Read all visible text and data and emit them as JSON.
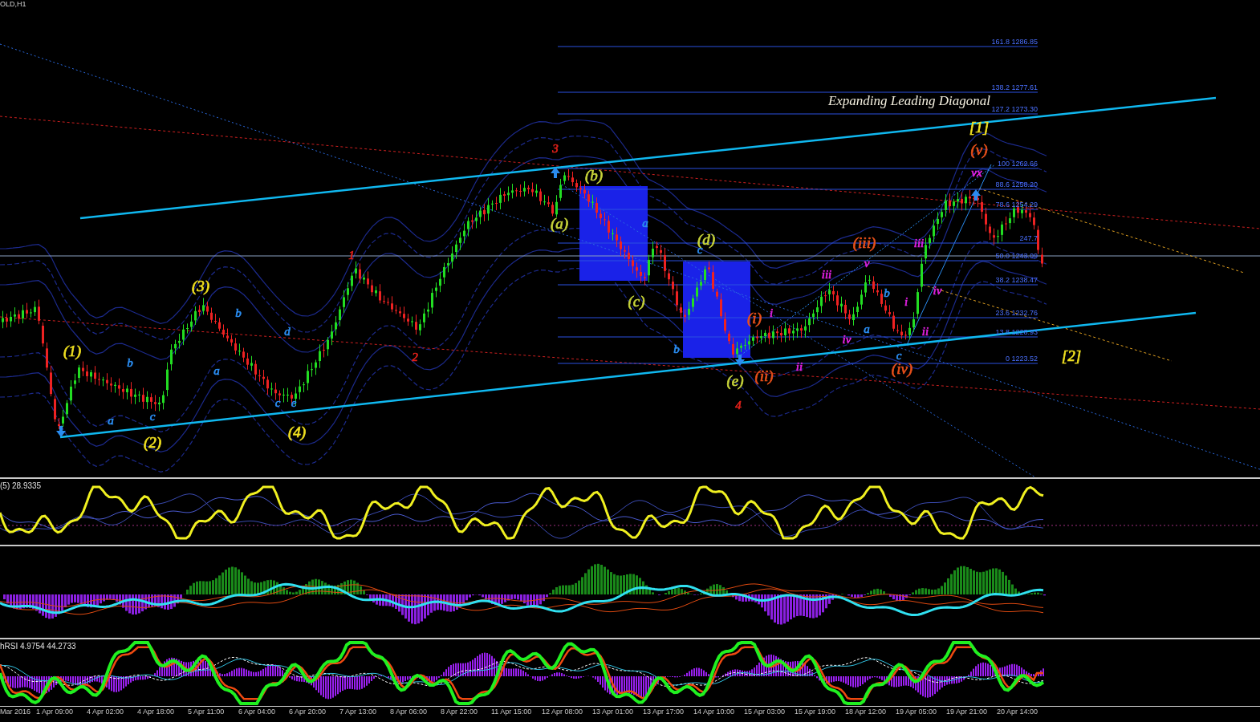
{
  "window": {
    "title": "OLD,H1"
  },
  "main_chart": {
    "annotation": "Expanding Leading Diagonal",
    "fib_levels": [
      {
        "label": "161.8 1286.85"
      },
      {
        "label": "138.2 1277.61"
      },
      {
        "label": "127.2 1273.30"
      },
      {
        "label": "100 1262.66"
      },
      {
        "label": "88.6 1258.20"
      },
      {
        "label": "78.6 1254.29"
      },
      {
        "label": "247.7"
      },
      {
        "label": "50.0 1243.09"
      },
      {
        "label": "38.2 1238.47"
      },
      {
        "label": "23.6 1232.76"
      },
      {
        "label": "13.8 1228.93"
      },
      {
        "label": "0 1223.52"
      }
    ],
    "wave_labels": [
      {
        "text": "(1)",
        "color": "#f0e020"
      },
      {
        "text": "a",
        "color": "#2a8cf0"
      },
      {
        "text": "b",
        "color": "#2a8cf0"
      },
      {
        "text": "(2)",
        "color": "#f0e020"
      },
      {
        "text": "c",
        "color": "#2a8cf0"
      },
      {
        "text": "(3)",
        "color": "#f0e020"
      },
      {
        "text": "a",
        "color": "#2a8cf0"
      },
      {
        "text": "b",
        "color": "#2a8cf0"
      },
      {
        "text": "c",
        "color": "#2a8cf0"
      },
      {
        "text": "d",
        "color": "#2a8cf0"
      },
      {
        "text": "e",
        "color": "#2a8cf0"
      },
      {
        "text": "(4)",
        "color": "#f0e020"
      },
      {
        "text": "1",
        "color": "#e0201a"
      },
      {
        "text": "2",
        "color": "#e0201a"
      },
      {
        "text": "3",
        "color": "#e0201a"
      },
      {
        "text": "(a)",
        "color": "#c8d43a"
      },
      {
        "text": "(b)",
        "color": "#c8d43a"
      },
      {
        "text": "(c)",
        "color": "#c8d43a"
      },
      {
        "text": "a",
        "color": "#2a8cf0"
      },
      {
        "text": "b",
        "color": "#2a8cf0"
      },
      {
        "text": "c",
        "color": "#2a8cf0"
      },
      {
        "text": "(d)",
        "color": "#c8d43a"
      },
      {
        "text": "(e)",
        "color": "#c8d43a"
      },
      {
        "text": "4",
        "color": "#e0201a"
      },
      {
        "text": "(i)",
        "color": "#e8501a"
      },
      {
        "text": "(ii)",
        "color": "#e8501a"
      },
      {
        "text": "i",
        "color": "#e020e0"
      },
      {
        "text": "ii",
        "color": "#e020e0"
      },
      {
        "text": "iii",
        "color": "#e020e0"
      },
      {
        "text": "iv",
        "color": "#e020e0"
      },
      {
        "text": "(iii)",
        "color": "#e8501a"
      },
      {
        "text": "v",
        "color": "#e020e0"
      },
      {
        "text": "a",
        "color": "#2a8cf0"
      },
      {
        "text": "b",
        "color": "#2a8cf0"
      },
      {
        "text": "i",
        "color": "#e020e0"
      },
      {
        "text": "c",
        "color": "#2a8cf0"
      },
      {
        "text": "(iv)",
        "color": "#e8501a"
      },
      {
        "text": "iii",
        "color": "#e020e0"
      },
      {
        "text": "ii",
        "color": "#e020e0"
      },
      {
        "text": "iv",
        "color": "#e020e0"
      },
      {
        "text": "[1]",
        "color": "#f0e020"
      },
      {
        "text": "(v)",
        "color": "#e8501a"
      },
      {
        "text": "vx",
        "color": "#e020e0"
      },
      {
        "text": "[2]",
        "color": "#f0e020"
      }
    ]
  },
  "oscillator_pane": {
    "label": "(5) 28.9335"
  },
  "rsi_pane": {
    "label": "hRSI 4.9754 44.2733"
  },
  "time_axis": [
    "Mar 2016",
    "1 Apr 09:00",
    "4 Apr 02:00",
    "4 Apr 18:00",
    "5 Apr 11:00",
    "6 Apr 04:00",
    "6 Apr 20:00",
    "7 Apr 13:00",
    "8 Apr 06:00",
    "8 Apr 22:00",
    "11 Apr 15:00",
    "12 Apr 08:00",
    "13 Apr 01:00",
    "13 Apr 17:00",
    "14 Apr 10:00",
    "15 Apr 03:00",
    "15 Apr 19:00",
    "18 Apr 12:00",
    "19 Apr 05:00",
    "19 Apr 21:00",
    "20 Apr 14:00"
  ]
}
